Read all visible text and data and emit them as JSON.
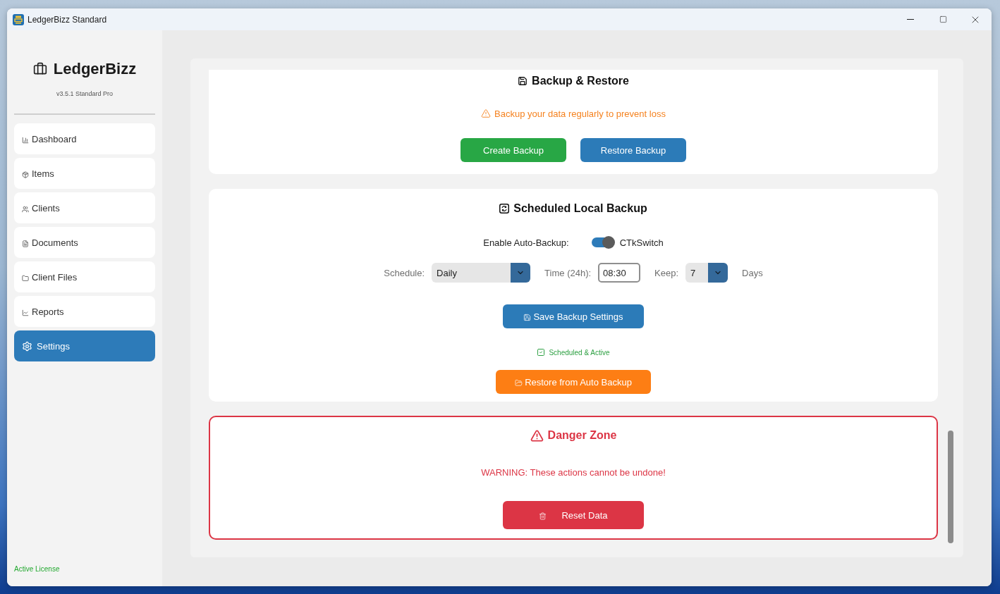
{
  "window": {
    "title": "LedgerBizz Standard"
  },
  "sidebar": {
    "brand": "LedgerBizz",
    "version": "v3.5.1 Standard Pro",
    "items": [
      {
        "label": "Dashboard",
        "selected": false
      },
      {
        "label": "Items",
        "selected": false
      },
      {
        "label": "Clients",
        "selected": false
      },
      {
        "label": "Documents",
        "selected": false
      },
      {
        "label": "Client Files",
        "selected": false
      },
      {
        "label": "Reports",
        "selected": false
      },
      {
        "label": "Settings",
        "selected": true
      }
    ],
    "license_status": "Active License"
  },
  "backup_restore": {
    "title": "Backup & Restore",
    "notice": "Backup your data regularly to prevent loss",
    "buttons": [
      {
        "label": "Create Backup",
        "kind": "success"
      },
      {
        "label": "Restore Backup",
        "kind": "primary"
      }
    ]
  },
  "scheduled_backup": {
    "title": "Scheduled Local Backup",
    "auto_backup": {
      "label": "Enable Auto-Backup:",
      "switch_label": "CTkSwitch",
      "on": true
    },
    "schedule": {
      "label": "Schedule:",
      "value": "Daily"
    },
    "time": {
      "label": "Time (24h):",
      "value": "08:30"
    },
    "keep": {
      "label": "Keep:",
      "value": "7",
      "unit": "Days"
    },
    "save_button": "Save Backup Settings",
    "status": "Scheduled & Active",
    "restore_button": "Restore from Auto Backup"
  },
  "danger_zone": {
    "title": "Danger Zone",
    "warning": "WARNING: These actions cannot be undone!",
    "reset_button": "Reset Data"
  }
}
